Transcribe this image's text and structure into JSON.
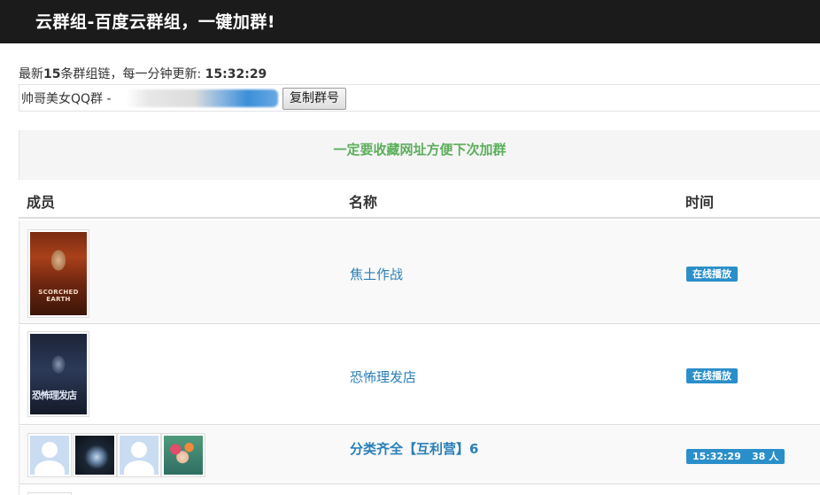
{
  "header": {
    "title": "云群组-百度云群组，一键加群!"
  },
  "update": {
    "prefix": "最新",
    "count": "15",
    "middle": "条群组链，每一分钟更新: ",
    "time": "15:32:29"
  },
  "copy_bar": {
    "label": "帅哥美女QQ群 - ",
    "button": "复制群号"
  },
  "notice": "一定要收藏网址方便下次加群",
  "table": {
    "columns": {
      "members": "成员",
      "name": "名称",
      "time": "时间"
    },
    "rows": [
      {
        "name": "焦土作战",
        "badges": [
          "在线播放"
        ],
        "poster_caption": "SCORCHED EARTH"
      },
      {
        "name": "恐怖理发店",
        "badges": [
          "在线播放"
        ],
        "poster_caption": "恐怖理发店"
      },
      {
        "name": "分类齐全【互利营】6",
        "badges": [
          "15:32:29",
          "38 人"
        ]
      }
    ]
  },
  "colors": {
    "topbar": "#1b1b1b",
    "link": "#2a7fb8",
    "badge": "#2a8fc9",
    "notice": "#5cae5c"
  }
}
